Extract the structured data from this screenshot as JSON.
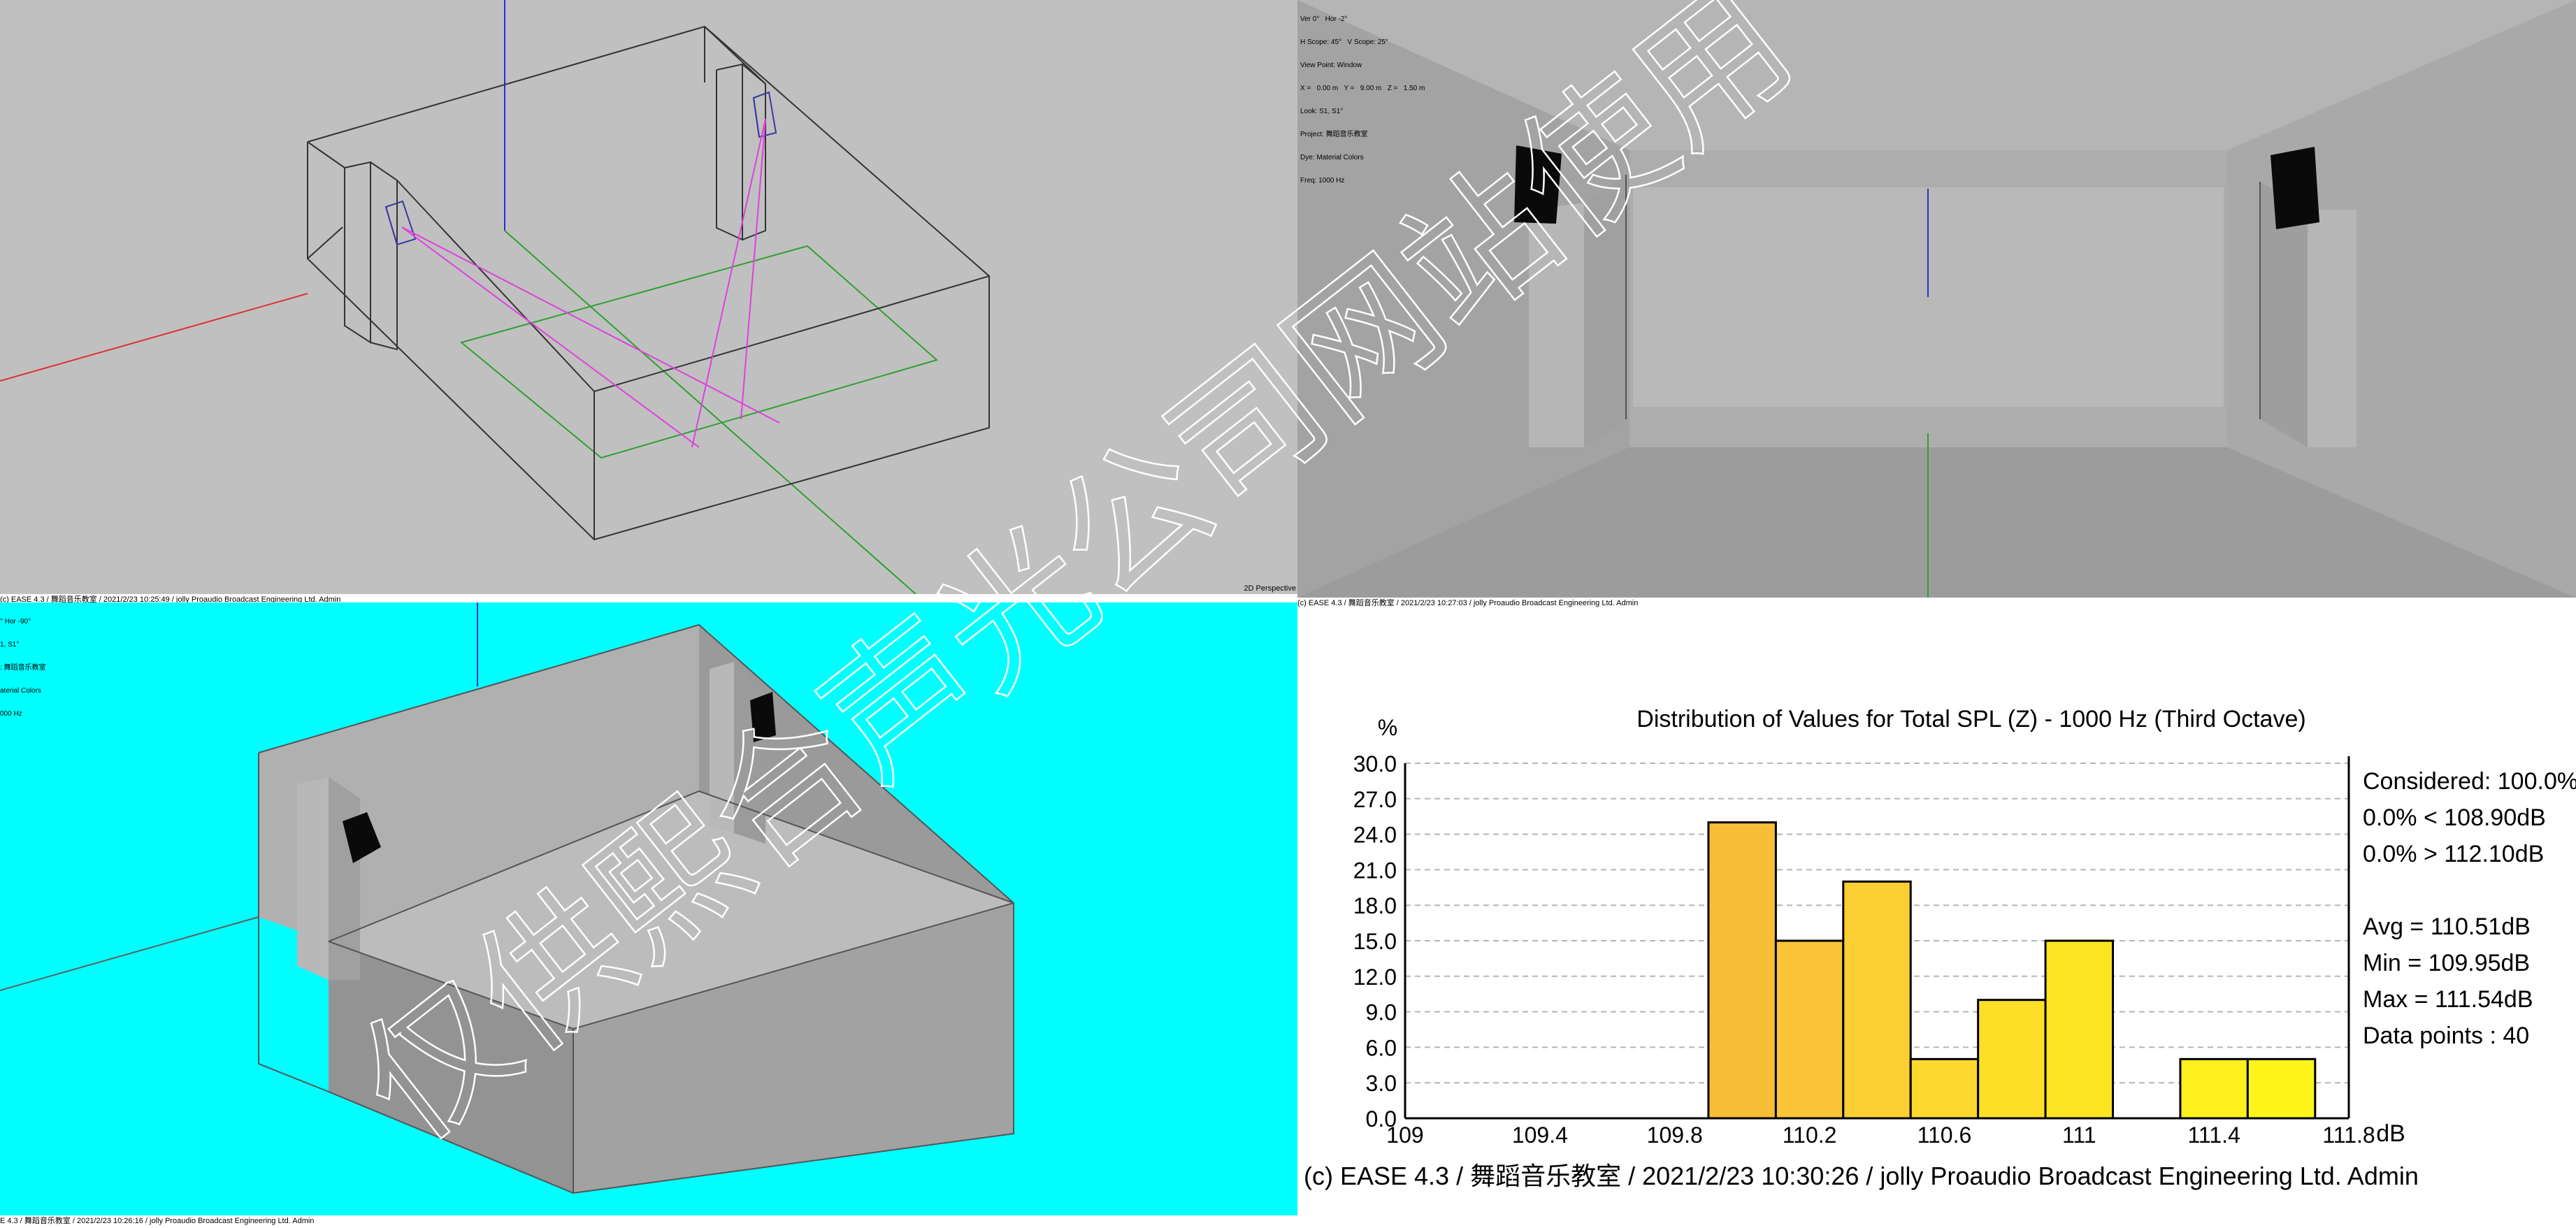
{
  "panes": {
    "wireframe": {
      "view_label": "2D Perspective",
      "footer": "(c) EASE 4.3  / 舞蹈音乐教室  / 2021/2/23 10:25:49 / jolly Proaudio Broadcast Engineering Ltd. Admin"
    },
    "render_gray": {
      "info": [
        "Ver 0°   Hor -2°",
        "H Scope: 45°   V Scope: 25°",
        "View Point: Window",
        "X =   0.00 m   Y =   9.00 m   Z =   1.50 m",
        "Look: S1, S1°",
        "Project: 舞蹈音乐教室",
        "Dye: Material Colors",
        "Freq: 1000 Hz"
      ],
      "footer": "(c) EASE 4.3  / 舞蹈音乐教室  / 2021/2/23 10:27:03 / jolly Proaudio Broadcast Engineering Ltd. Admin"
    },
    "render_cyan": {
      "info": [
        "° Hor -90°",
        "1, S1°",
        ": 舞蹈音乐教室",
        "aterial Colors",
        "000 Hz"
      ],
      "footer": "E 4.3  / 舞蹈音乐教室  / 2021/2/23 10:26:16 / jolly Proaudio Broadcast Engineering Ltd. Admin"
    }
  },
  "histogram": {
    "footer": "(c) EASE 4.3  / 舞蹈音乐教室  / 2021/2/23 10:30:26 / jolly Proaudio Broadcast Engineering Ltd. Admin",
    "stats": {
      "considered": "Considered: 100.0%",
      "below": "0.0%  < 108.90dB",
      "above": "0.0%  > 112.10dB",
      "avg": "Avg = 110.51dB",
      "min": "Min = 109.95dB",
      "max": "Max = 111.54dB",
      "points": "Data points : 40"
    }
  },
  "chart_data": {
    "type": "bar",
    "title": "Distribution of Values for Total SPL (Z)  - 1000 Hz (Third Octave)",
    "ylabel": "%",
    "xlabel": "dB",
    "ylim": [
      0,
      30
    ],
    "xlim": [
      109,
      111.8
    ],
    "yticks": [
      "0.0",
      "3.0",
      "6.0",
      "9.0",
      "12.0",
      "15.0",
      "18.0",
      "21.0",
      "24.0",
      "27.0",
      "30.0"
    ],
    "xticks": [
      "109",
      "109.4",
      "109.8",
      "110.2",
      "110.6",
      "111",
      "111.4",
      "111.8"
    ],
    "grid": true,
    "bars": [
      {
        "x0": 109.9,
        "x1": 110.1,
        "value": 25,
        "color": "#f9be38"
      },
      {
        "x0": 110.1,
        "x1": 110.3,
        "value": 15,
        "color": "#fac538"
      },
      {
        "x0": 110.3,
        "x1": 110.5,
        "value": 20,
        "color": "#fbcf34"
      },
      {
        "x0": 110.5,
        "x1": 110.7,
        "value": 5,
        "color": "#fcd82e"
      },
      {
        "x0": 110.7,
        "x1": 110.9,
        "value": 10,
        "color": "#fddf28"
      },
      {
        "x0": 110.9,
        "x1": 111.1,
        "value": 15,
        "color": "#fde522"
      },
      {
        "x0": 111.3,
        "x1": 111.5,
        "value": 5,
        "color": "#fdf01c"
      },
      {
        "x0": 111.5,
        "x1": 111.7,
        "value": 5,
        "color": "#fdf51a"
      }
    ]
  },
  "watermark": {
    "text": "仅供熙合声光公司网站使用"
  }
}
